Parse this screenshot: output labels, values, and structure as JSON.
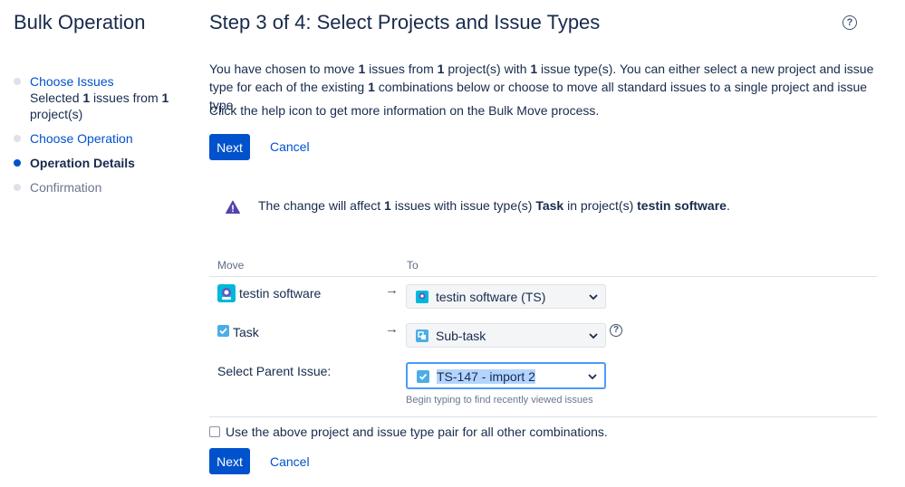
{
  "sidebar": {
    "title": "Bulk Operation",
    "steps": [
      {
        "label": "Choose Issues",
        "sub_pre": "Selected ",
        "sub_count1": "1",
        "sub_mid": " issues from ",
        "sub_count2": "1",
        "sub_post": " project(s)"
      },
      {
        "label": "Choose Operation"
      },
      {
        "label": "Operation Details"
      },
      {
        "label": "Confirmation"
      }
    ]
  },
  "main": {
    "title": "Step 3 of 4: Select Projects and Issue Types",
    "intro": {
      "t1": "You have chosen to move ",
      "b1": "1",
      "t2": " issues from ",
      "b2": "1",
      "t3": " project(s) with ",
      "b3": "1",
      "t4": " issue type(s). You can either select a new project and issue type for each of the existing ",
      "b4": "1",
      "t5": " combinations below or choose to move all standard issues to a single project and issue type."
    },
    "help_text": "Click the help icon to get more information on the Bulk Move process.",
    "next_label": "Next",
    "cancel_label": "Cancel",
    "warning": {
      "t1": "The change will affect ",
      "b1": "1",
      "t2": " issues with issue type(s) ",
      "b2": "Task",
      "t3": " in project(s) ",
      "b3": "testin software",
      "t4": "."
    },
    "table": {
      "col_move": "Move",
      "col_to": "To",
      "arrow": "→",
      "project_from": "testin software",
      "project_to": "testin software (TS)",
      "type_from": "Task",
      "type_to": "Sub-task",
      "parent_label": "Select Parent Issue:",
      "parent_value": "TS-147 - import 2",
      "parent_hint": "Begin typing to find recently viewed issues"
    },
    "use_above_label": "Use the above project and issue type pair for all other combinations.",
    "help_symbol": "?"
  },
  "colors": {
    "primary": "#0052CC",
    "text": "#172B4D",
    "warning_icon": "#5243AA",
    "focus": "#4C9AFF"
  },
  "icons": [
    "help-icon",
    "warning-icon",
    "project-avatar-icon",
    "task-icon",
    "subtask-icon",
    "chevron-down-icon",
    "arrow-right-icon"
  ]
}
